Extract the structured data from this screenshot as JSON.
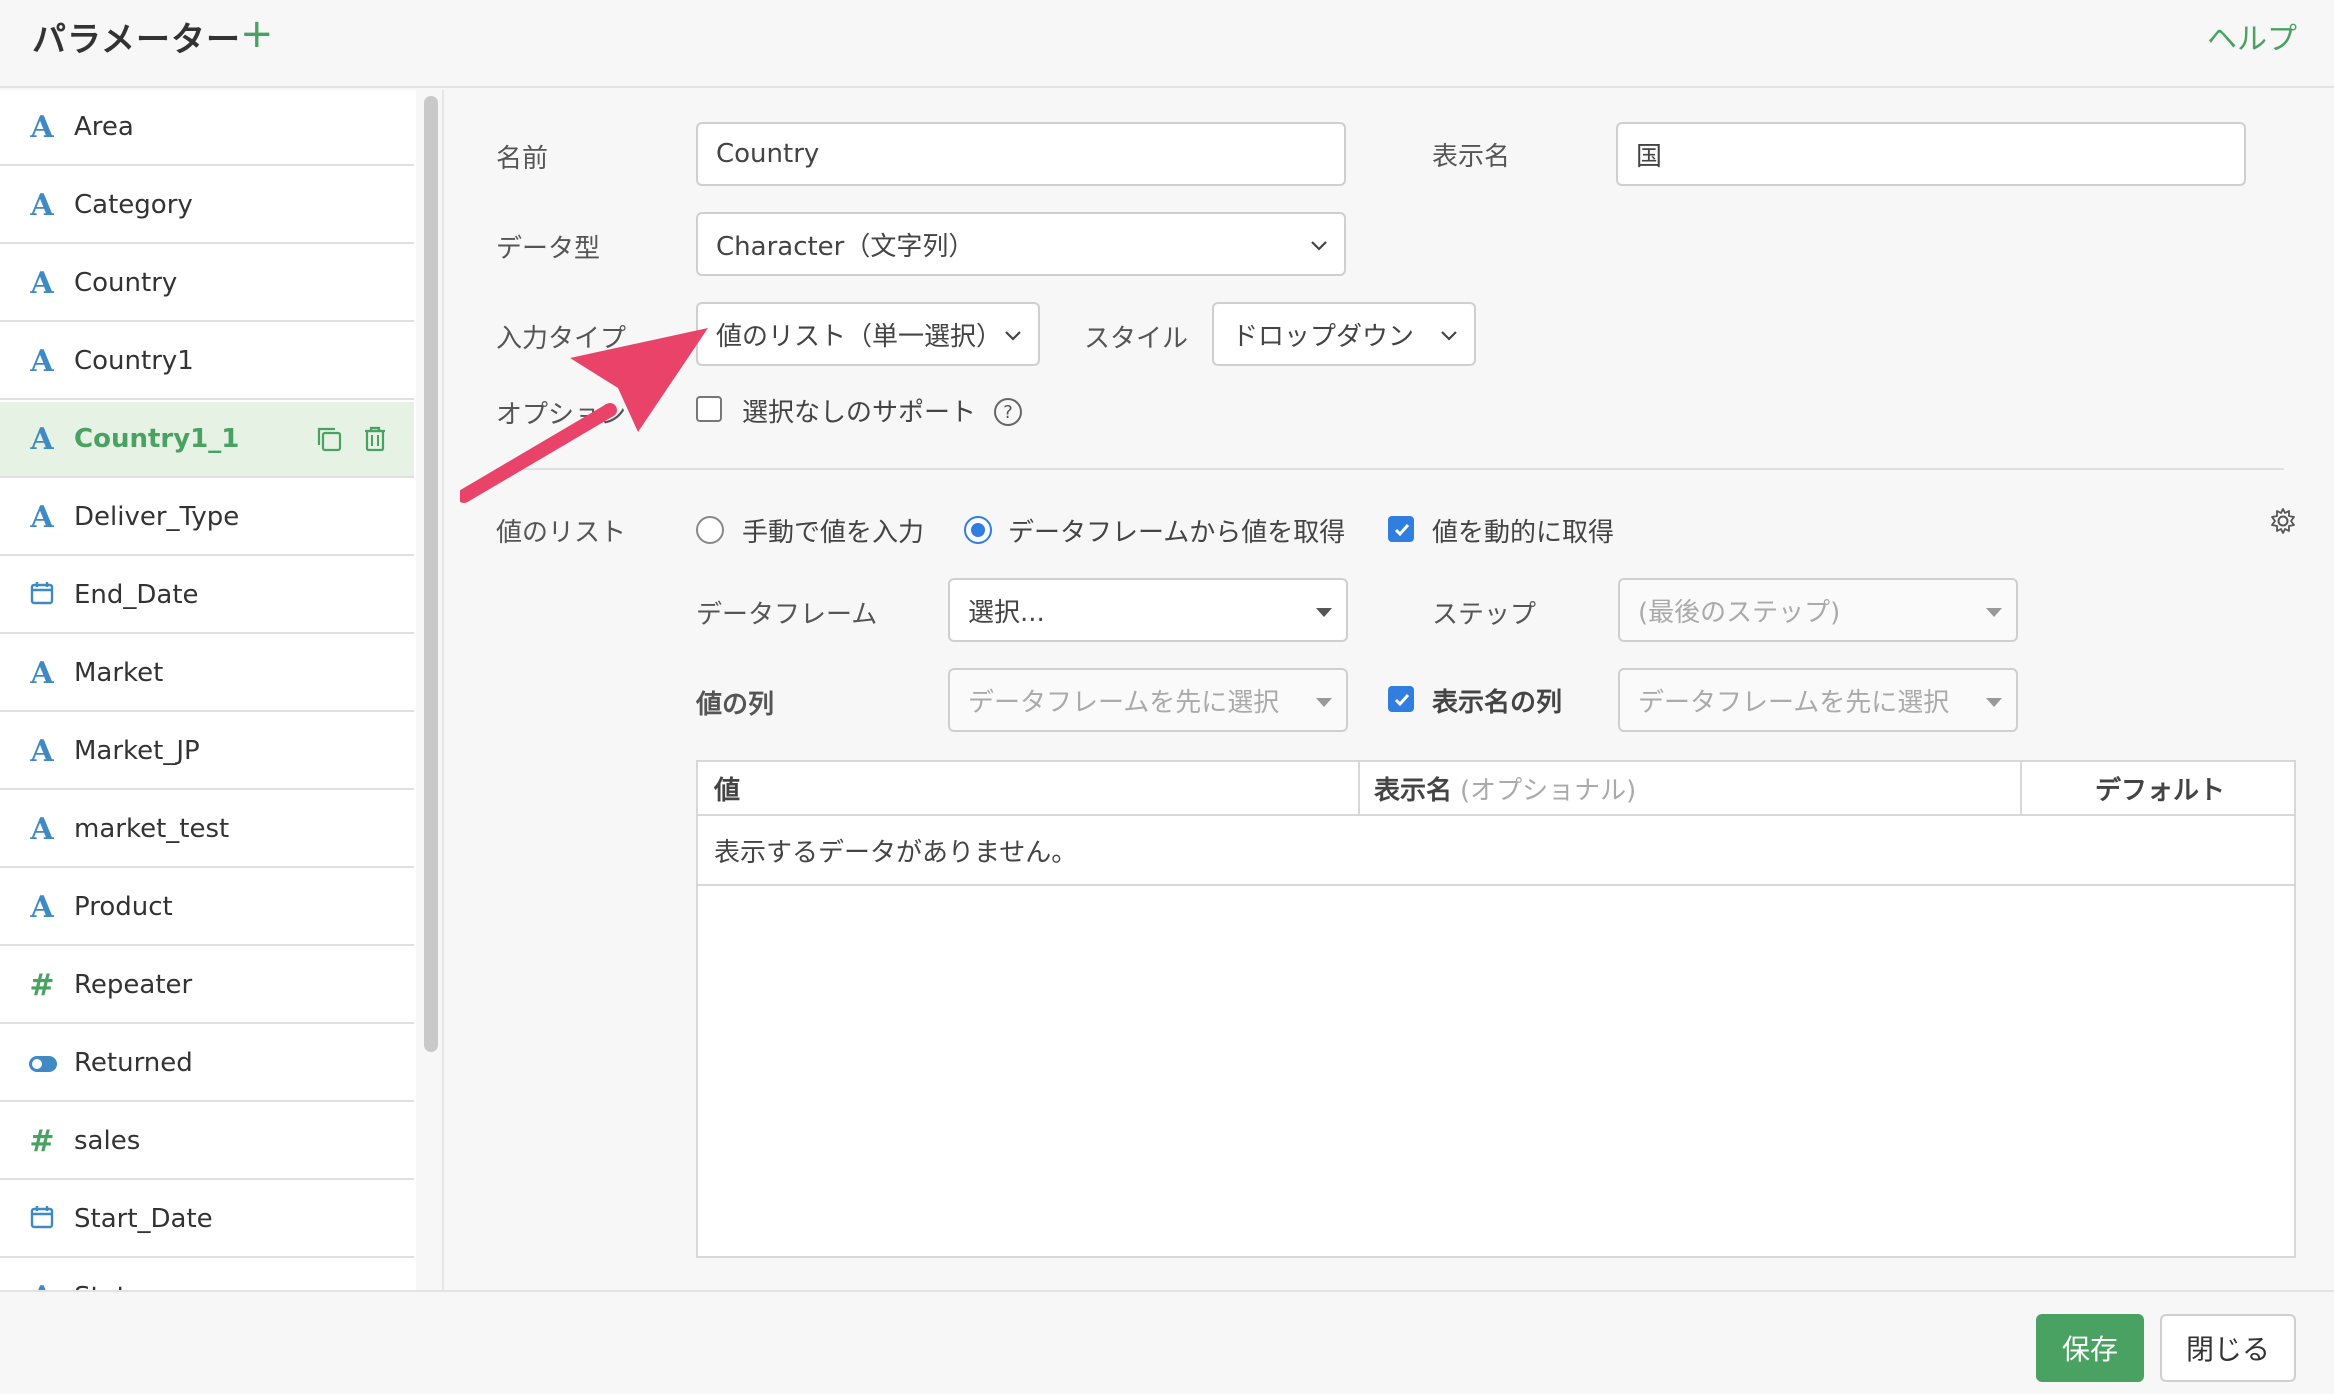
{
  "header": {
    "title": "パラメーター",
    "add_label": "+",
    "help_label": "ヘルプ"
  },
  "sidebar": {
    "items": [
      {
        "label": "Area",
        "icon": "A",
        "type": "text"
      },
      {
        "label": "Category",
        "icon": "A",
        "type": "text"
      },
      {
        "label": "Country",
        "icon": "A",
        "type": "text"
      },
      {
        "label": "Country1",
        "icon": "A",
        "type": "text"
      },
      {
        "label": "Country1_1",
        "icon": "A",
        "type": "text",
        "active": true
      },
      {
        "label": "Deliver_Type",
        "icon": "A",
        "type": "text"
      },
      {
        "label": "End_Date",
        "icon": "calendar-icon",
        "type": "date"
      },
      {
        "label": "Market",
        "icon": "A",
        "type": "text"
      },
      {
        "label": "Market_JP",
        "icon": "A",
        "type": "text"
      },
      {
        "label": "market_test",
        "icon": "A",
        "type": "text"
      },
      {
        "label": "Product",
        "icon": "A",
        "type": "text"
      },
      {
        "label": "Repeater",
        "icon": "#",
        "type": "number"
      },
      {
        "label": "Returned",
        "icon": "toggle-icon",
        "type": "logical"
      },
      {
        "label": "sales",
        "icon": "#",
        "type": "number"
      },
      {
        "label": "Start_Date",
        "icon": "calendar-icon",
        "type": "date"
      },
      {
        "label": "State",
        "icon": "A",
        "type": "text"
      }
    ]
  },
  "form": {
    "name_label": "名前",
    "name_value": "Country",
    "display_name_label": "表示名",
    "display_name_value": "国",
    "data_type_label": "データ型",
    "data_type_value": "Character（文字列）",
    "input_type_label": "入力タイプ",
    "input_type_value": "値のリスト（単一選択）",
    "style_label": "スタイル",
    "style_value": "ドロップダウン",
    "option_label": "オプション",
    "option_checkbox_label": "選択なしのサポート",
    "help_glyph": "?",
    "value_list_label": "値のリスト",
    "radio_manual_label": "手動で値を入力",
    "radio_dataframe_label": "データフレームから値を取得",
    "dynamic_label": "値を動的に取得",
    "dataframe_label": "データフレーム",
    "dataframe_value": "選択...",
    "step_label": "ステップ",
    "step_value": "(最後のステップ)",
    "value_column_label": "値の列",
    "value_column_value": "データフレームを先に選択",
    "display_column_label": "表示名の列",
    "display_column_value": "データフレームを先に選択"
  },
  "table": {
    "col_value": "値",
    "col_display_name": "表示名",
    "col_display_name_sub": "(オプショナル)",
    "col_default": "デフォルト",
    "empty_message": "表示するデータがありません。"
  },
  "footer": {
    "save_label": "保存",
    "close_label": "閉じる"
  },
  "colors": {
    "accent_green": "#4aa262",
    "checkbox_blue": "#2f7ee0",
    "arrow_pink": "#e9436a",
    "icon_blue": "#3f8ac4"
  }
}
